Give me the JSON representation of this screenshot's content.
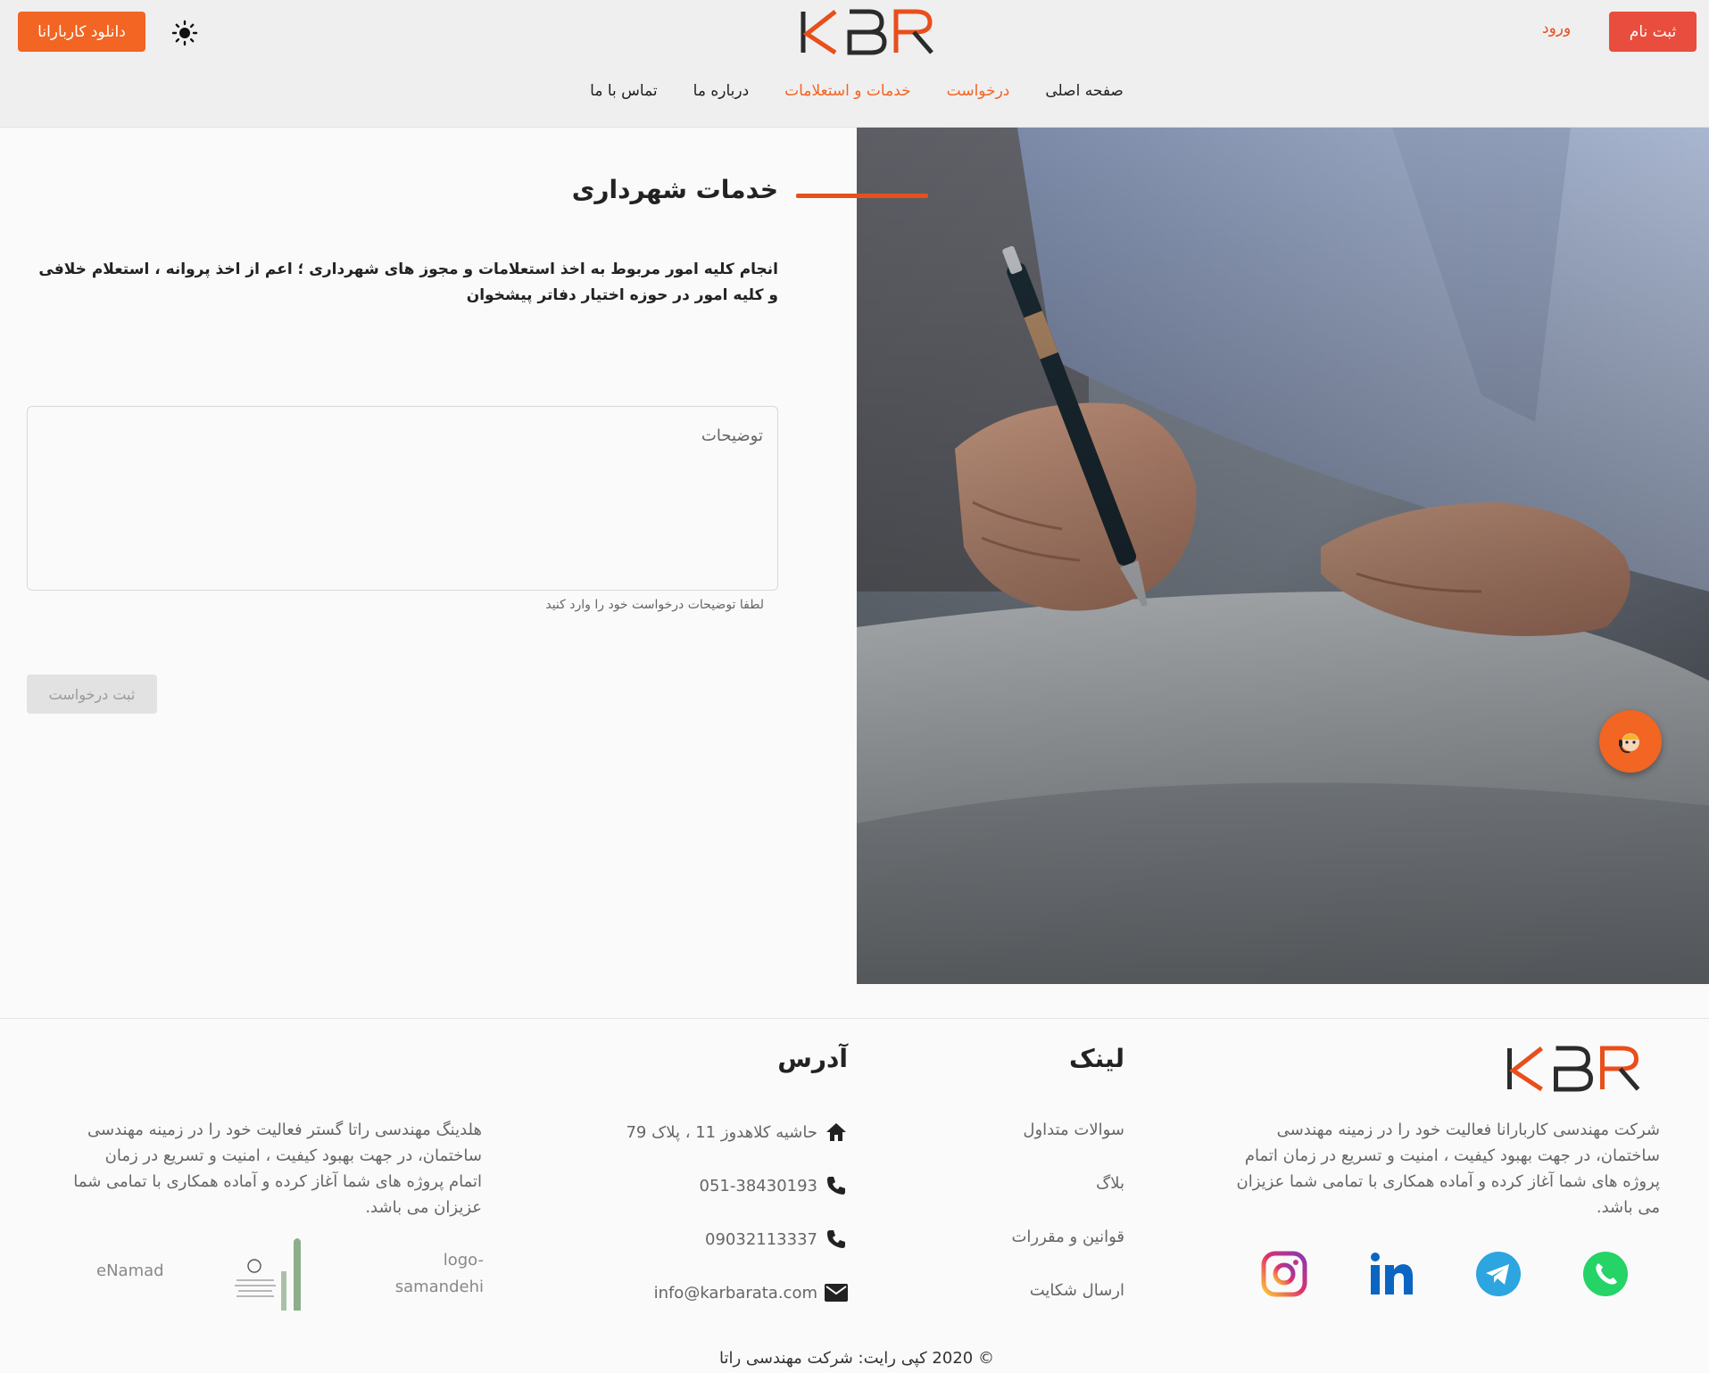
{
  "header": {
    "download_label": "دانلود کاربارانا",
    "logo_text": "KBR",
    "login_label": "ورود",
    "register_label": "ثبت نام",
    "nav": [
      {
        "label": "صفحه اصلی",
        "active": false
      },
      {
        "label": "درخواست",
        "active": true
      },
      {
        "label": "خدمات و استعلامات",
        "active": true
      },
      {
        "label": "درباره ما",
        "active": false
      },
      {
        "label": "تماس با ما",
        "active": false
      }
    ]
  },
  "main": {
    "title": "خدمات شهرداری",
    "description": "انجام کلیه امور مربوط به اخذ استعلامات و مجوز های شهرداری ؛ اعم از اخذ پروانه ، استعلام خلافی و کلیه امور در حوزه اختیار دفاتر پیشخوان",
    "textarea_placeholder": "توضیحات",
    "helper_text": "لطفا توضیحات درخواست خود را وارد کنید",
    "submit_label": "ثبت درخواست"
  },
  "footer": {
    "about": "شرکت مهندسی کاربارانا فعالیت خود را در زمینه مهندسی ساختمان، در جهت بهبود کیفیت ، امنیت و تسریع در زمان اتمام پروژه های شما آغاز کرده و آماده همکاری با تمامی شما عزیزان می باشد.",
    "links_title": "لینک",
    "links": [
      "سوالات متداول",
      "بلاگ",
      "قوانین و مقررات",
      "ارسال شکایت"
    ],
    "address_title": "آدرس",
    "address": "حاشیه کلاهدوز 11 ، پلاک 79",
    "phone1": "051-38430193",
    "phone2": "09032113337",
    "email": "info@karbarata.com",
    "holding_about": "هلدینگ مهندسی راتا گستر فعالیت خود را در زمینه مهندسی ساختمان، در جهت بهبود کیفیت ، امنیت و تسریع در زمان اتمام پروژه های شما آغاز کرده و آماده همکاری با تمامی شما عزیزان می باشد.",
    "samandehi_alt": "logo-samandehi",
    "enamad_alt": "eNamad",
    "copyright": "© 2020 کپی رایت: شرکت مهندسی راتا",
    "social_icons": [
      "whatsapp-icon",
      "telegram-icon",
      "linkedin-icon",
      "instagram-icon"
    ]
  },
  "colors": {
    "accent": "#f26522",
    "register": "#e94d3d",
    "whatsapp": "#25d366",
    "telegram": "#2ca5e0",
    "linkedin": "#0a66c2"
  }
}
